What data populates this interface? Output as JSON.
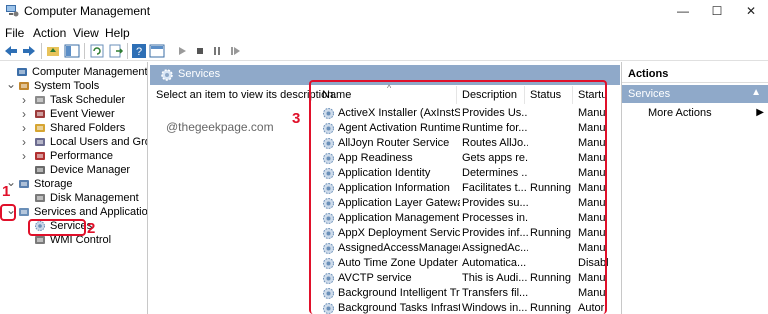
{
  "window": {
    "title": "Computer Management",
    "controls": {
      "minimize": "—",
      "maximize": "☐",
      "close": "✕"
    }
  },
  "menu": [
    "File",
    "Action",
    "View",
    "Help"
  ],
  "tree": [
    {
      "label": "Computer Management (Local",
      "icon": "computer-icon",
      "arrow": ""
    },
    {
      "label": "System Tools",
      "icon": "tools-icon",
      "arrow": "v"
    },
    {
      "label": "Task Scheduler",
      "icon": "clock-icon",
      "arrow": ">"
    },
    {
      "label": "Event Viewer",
      "icon": "event-icon",
      "arrow": ">"
    },
    {
      "label": "Shared Folders",
      "icon": "folder-icon",
      "arrow": ">"
    },
    {
      "label": "Local Users and Groups",
      "icon": "users-icon",
      "arrow": ">"
    },
    {
      "label": "Performance",
      "icon": "performance-icon",
      "arrow": ">"
    },
    {
      "label": "Device Manager",
      "icon": "device-icon",
      "arrow": ""
    },
    {
      "label": "Storage",
      "icon": "storage-icon",
      "arrow": "v"
    },
    {
      "label": "Disk Management",
      "icon": "disk-icon",
      "arrow": ""
    },
    {
      "label": "Services and Applications",
      "icon": "services-apps-icon",
      "arrow": "v"
    },
    {
      "label": "Services",
      "icon": "gear-icon",
      "arrow": ""
    },
    {
      "label": "WMI Control",
      "icon": "wmi-icon",
      "arrow": ""
    }
  ],
  "middle": {
    "header": "Services",
    "description": "Select an item to view its description.",
    "watermark": "@thegeekpage.com",
    "columns": {
      "name": "Name",
      "description": "Description",
      "status": "Status",
      "startup": "Startu"
    },
    "services": [
      {
        "name": "ActiveX Installer (AxInstSV)",
        "description": "Provides Us...",
        "status": "",
        "startup": "Manu"
      },
      {
        "name": "Agent Activation Runtime_...",
        "description": "Runtime for...",
        "status": "",
        "startup": "Manu"
      },
      {
        "name": "AllJoyn Router Service",
        "description": "Routes AllJo...",
        "status": "",
        "startup": "Manu"
      },
      {
        "name": "App Readiness",
        "description": "Gets apps re...",
        "status": "",
        "startup": "Manu"
      },
      {
        "name": "Application Identity",
        "description": "Determines ...",
        "status": "",
        "startup": "Manu"
      },
      {
        "name": "Application Information",
        "description": "Facilitates t...",
        "status": "Running",
        "startup": "Manu"
      },
      {
        "name": "Application Layer Gateway ...",
        "description": "Provides su...",
        "status": "",
        "startup": "Manu"
      },
      {
        "name": "Application Management",
        "description": "Processes in...",
        "status": "",
        "startup": "Manu"
      },
      {
        "name": "AppX Deployment Service (...",
        "description": "Provides inf...",
        "status": "Running",
        "startup": "Manu"
      },
      {
        "name": "AssignedAccessManager Se...",
        "description": "AssignedAc...",
        "status": "",
        "startup": "Manu"
      },
      {
        "name": "Auto Time Zone Updater",
        "description": "Automatica...",
        "status": "",
        "startup": "Disabl"
      },
      {
        "name": "AVCTP service",
        "description": "This is Audi...",
        "status": "Running",
        "startup": "Manu"
      },
      {
        "name": "Background Intelligent Tran...",
        "description": "Transfers fil...",
        "status": "",
        "startup": "Manu"
      },
      {
        "name": "Background Tasks Infrastruc...",
        "description": "Windows in...",
        "status": "Running",
        "startup": "Autor"
      }
    ]
  },
  "actions": {
    "title": "Actions",
    "section": "Services",
    "more": "More Actions"
  },
  "annotations": {
    "one": "1",
    "two": "2",
    "three": "3"
  },
  "colors": {
    "accent": "#8fa9c9",
    "annotation": "#e0102a"
  }
}
